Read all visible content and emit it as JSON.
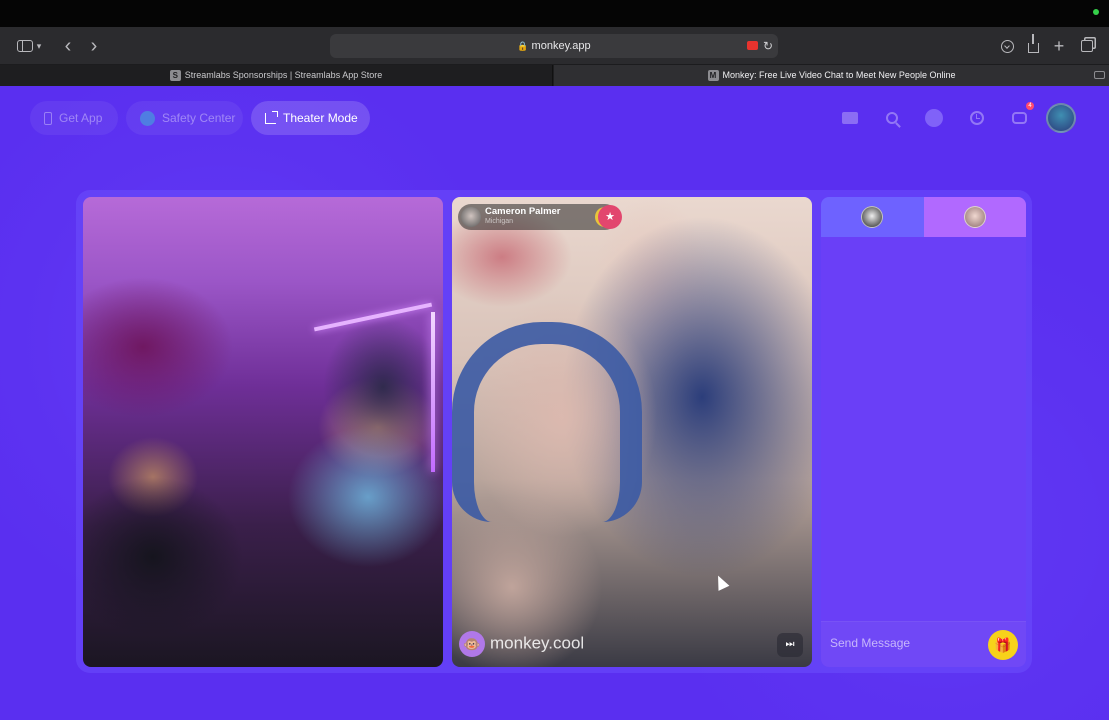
{
  "browser": {
    "url": "monkey.app",
    "tabs": [
      {
        "label": "Streamlabs Sponsorships | Streamlabs App Store",
        "favicon_letter": "S",
        "active": false
      },
      {
        "label": "Monkey: Free Live Video Chat to Meet New People Online",
        "favicon_letter": "M",
        "active": true
      }
    ]
  },
  "nav": {
    "get_app": "Get App",
    "safety_center": "Safety Center",
    "theater_mode": "Theater Mode",
    "chat_badge": "4"
  },
  "call": {
    "caller_name": "Cameron Palmer",
    "caller_location": "Michigan",
    "watermark": "monkey.cool"
  },
  "chat": {
    "placeholder": "Send Message"
  },
  "colors": {
    "app_background": "#5a2ff0",
    "accent_gift": "#f7d21a",
    "recording_indicator": "#e8332e"
  }
}
